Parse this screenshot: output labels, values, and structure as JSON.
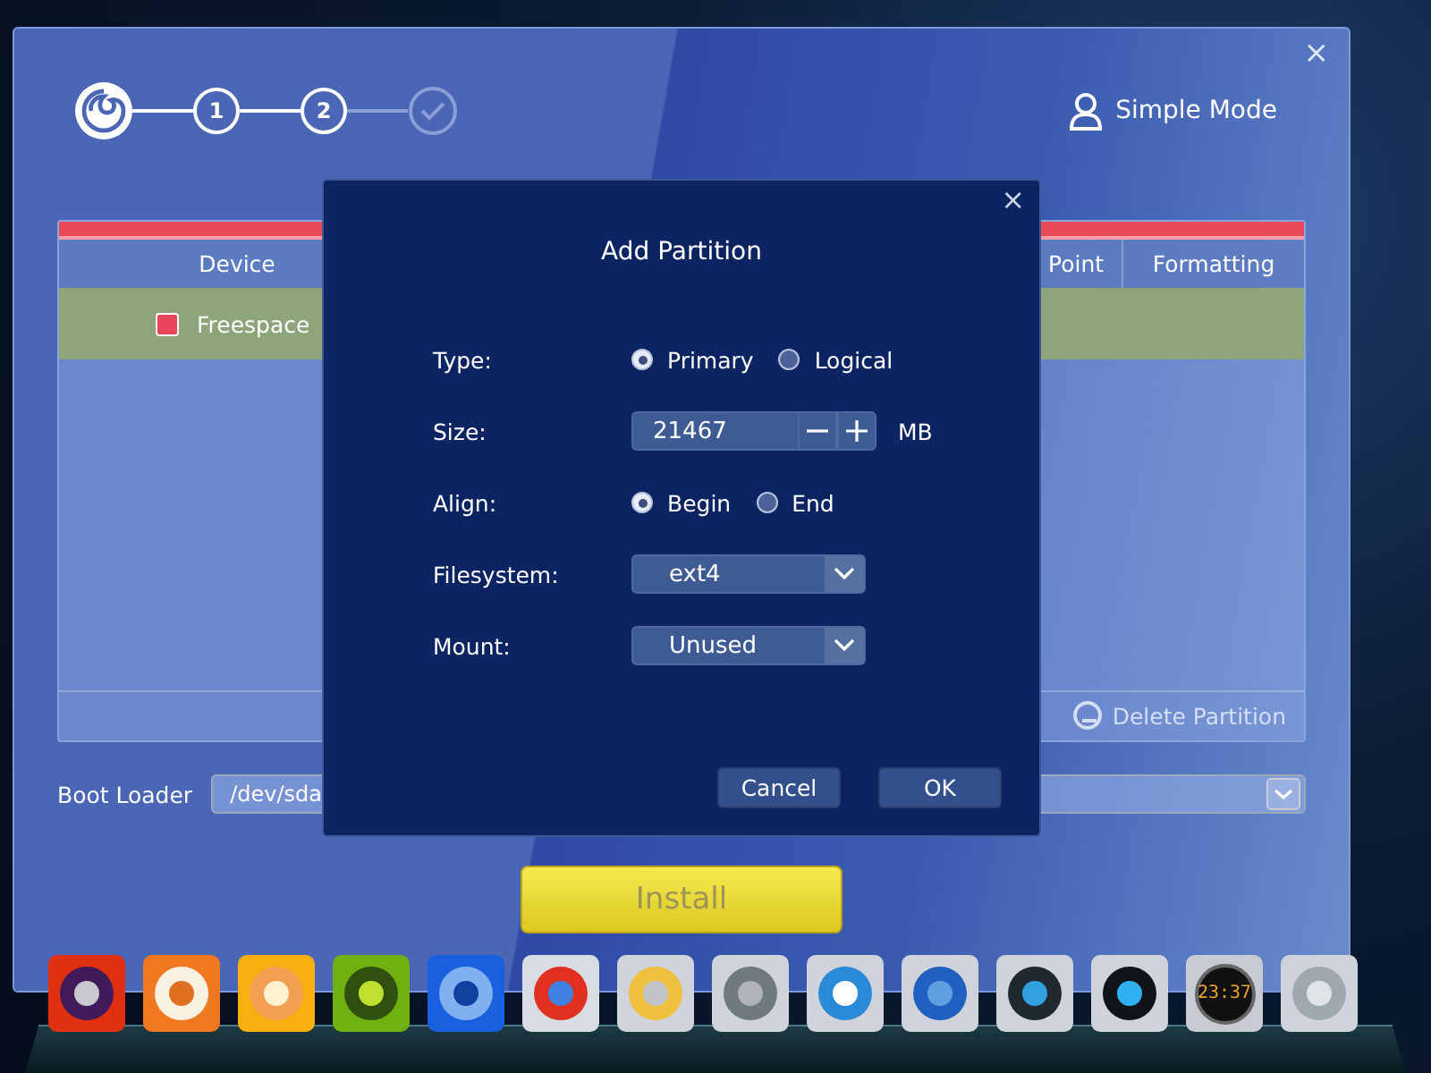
{
  "steps": [
    {
      "kind": "logo",
      "active": true
    },
    {
      "kind": "number",
      "label": "1",
      "active": true
    },
    {
      "kind": "number",
      "label": "2",
      "active": true
    },
    {
      "kind": "finish",
      "active": false
    }
  ],
  "mode_button": "Simple Mode",
  "table": {
    "columns": [
      "Device",
      "Point",
      "Formatting"
    ],
    "rows": [
      {
        "device": "Freespace",
        "color": "#e8465c",
        "selected": true
      }
    ]
  },
  "partition_actions": [
    {
      "label": "Delete Partition",
      "disabled": true
    }
  ],
  "boot_loader": {
    "label": "Boot Loader",
    "value": "/dev/sda"
  },
  "install_button": "Install",
  "dialog": {
    "title": "Add Partition",
    "close": "×",
    "fields": [
      {
        "kind": "radio",
        "label": "Type:",
        "options": [
          {
            "label": "Primary",
            "selected": true
          },
          {
            "label": "Logical",
            "selected": false
          }
        ]
      },
      {
        "kind": "spin",
        "label": "Size:",
        "value": "21467",
        "unit": "MB"
      },
      {
        "kind": "radio",
        "label": "Align:",
        "options": [
          {
            "label": "Begin",
            "selected": true
          },
          {
            "label": "End",
            "selected": false
          }
        ]
      },
      {
        "kind": "select",
        "label": "Filesystem:",
        "value": "ext4"
      },
      {
        "kind": "select",
        "label": "Mount:",
        "value": "Unused"
      }
    ],
    "buttons": [
      "Cancel",
      "OK"
    ]
  },
  "window_close": "×",
  "dock": {
    "clock": "23:37"
  }
}
